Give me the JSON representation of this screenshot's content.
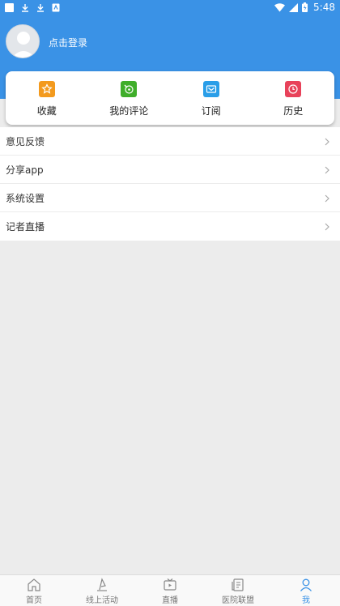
{
  "status_bar": {
    "time": "5:48",
    "icons": [
      "notification-square-icon",
      "download-icon",
      "download-icon",
      "app-icon",
      "wifi-icon",
      "signal-icon",
      "battery-icon"
    ]
  },
  "header": {
    "login_text": "点击登录",
    "background": "#3a92e6"
  },
  "quick_actions": [
    {
      "label": "收藏",
      "icon": "star-icon",
      "color": "#f39a1e"
    },
    {
      "label": "我的评论",
      "icon": "comment-icon",
      "color": "#3fae2a"
    },
    {
      "label": "订阅",
      "icon": "mail-icon",
      "color": "#2a9ee8"
    },
    {
      "label": "历史",
      "icon": "clock-icon",
      "color": "#e8425a"
    }
  ],
  "menu": [
    {
      "label": "意见反馈"
    },
    {
      "label": "分享app"
    },
    {
      "label": "系统设置"
    },
    {
      "label": "记者直播"
    }
  ],
  "bottom_nav": [
    {
      "label": "首页",
      "icon": "home-icon",
      "active": false
    },
    {
      "label": "线上活动",
      "icon": "flag-icon",
      "active": false
    },
    {
      "label": "直播",
      "icon": "tv-icon",
      "active": false
    },
    {
      "label": "医院联盟",
      "icon": "hospital-icon",
      "active": false
    },
    {
      "label": "我",
      "icon": "profile-icon",
      "active": true
    }
  ],
  "accent_color": "#3a92e6"
}
